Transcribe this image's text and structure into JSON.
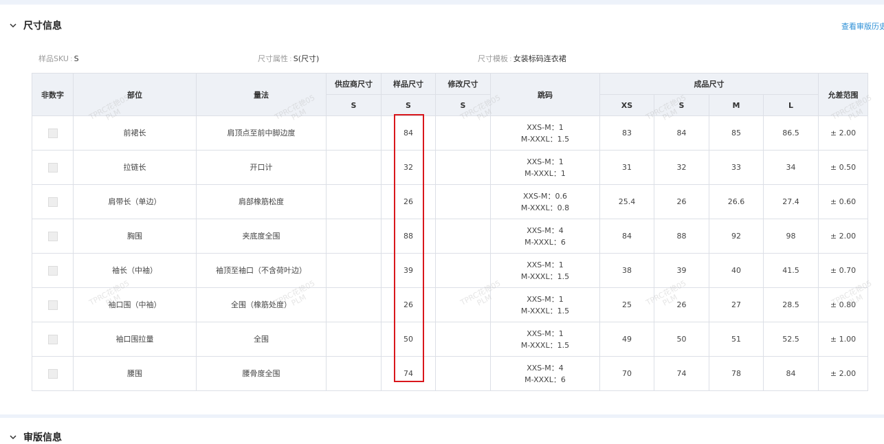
{
  "section": {
    "title": "尺寸信息",
    "history_link": "查看审版历史"
  },
  "info": [
    {
      "label": "样品SKU",
      "value": "S"
    },
    {
      "label": "尺寸属性",
      "value": "S(尺寸)"
    },
    {
      "label": "尺寸模板",
      "value": "女装标码连衣裙"
    }
  ],
  "table": {
    "headers": {
      "non_digit": "非数字",
      "part": "部位",
      "method": "量法",
      "supplier_size": "供应商尺寸",
      "sample_size": "样品尺寸",
      "modify_size": "修改尺寸",
      "jump": "跳码",
      "finished_size": "成品尺寸",
      "tolerance": "允差范围"
    },
    "sub_headers": {
      "supplier": "S",
      "sample": "S",
      "modify": "S",
      "finished": [
        "XS",
        "S",
        "M",
        "L"
      ]
    },
    "rows": [
      {
        "part": "前裙长",
        "method": "肩顶点至前中脚边度",
        "supplier": "",
        "sample": "84",
        "modify": "",
        "jump1": "XXS-M：1",
        "jump2": "M-XXXL：1.5",
        "xs": "83",
        "s": "84",
        "m": "85",
        "l": "86.5",
        "tol": "± 2.00"
      },
      {
        "part": "拉链长",
        "method": "开口计",
        "supplier": "",
        "sample": "32",
        "modify": "",
        "jump1": "XXS-M：1",
        "jump2": "M-XXXL：1",
        "xs": "31",
        "s": "32",
        "m": "33",
        "l": "34",
        "tol": "± 0.50"
      },
      {
        "part": "肩带长（单边）",
        "method": "肩部橡筋松度",
        "supplier": "",
        "sample": "26",
        "modify": "",
        "jump1": "XXS-M：0.6",
        "jump2": "M-XXXL：0.8",
        "xs": "25.4",
        "s": "26",
        "m": "26.6",
        "l": "27.4",
        "tol": "± 0.60"
      },
      {
        "part": "胸围",
        "method": "夹底度全围",
        "supplier": "",
        "sample": "88",
        "modify": "",
        "jump1": "XXS-M：4",
        "jump2": "M-XXXL：6",
        "xs": "84",
        "s": "88",
        "m": "92",
        "l": "98",
        "tol": "± 2.00"
      },
      {
        "part": "袖长（中袖）",
        "method": "袖顶至袖口（不含荷叶边）",
        "supplier": "",
        "sample": "39",
        "modify": "",
        "jump1": "XXS-M：1",
        "jump2": "M-XXXL：1.5",
        "xs": "38",
        "s": "39",
        "m": "40",
        "l": "41.5",
        "tol": "± 0.70"
      },
      {
        "part": "袖口围（中袖）",
        "method": "全围（橡筋处度）",
        "supplier": "",
        "sample": "26",
        "modify": "",
        "jump1": "XXS-M：1",
        "jump2": "M-XXXL：1.5",
        "xs": "25",
        "s": "26",
        "m": "27",
        "l": "28.5",
        "tol": "± 0.80"
      },
      {
        "part": "袖口围拉量",
        "method": "全围",
        "supplier": "",
        "sample": "50",
        "modify": "",
        "jump1": "XXS-M：1",
        "jump2": "M-XXXL：1.5",
        "xs": "49",
        "s": "50",
        "m": "51",
        "l": "52.5",
        "tol": "± 1.00"
      },
      {
        "part": "腰围",
        "method": "腰骨度全围",
        "supplier": "",
        "sample": "74",
        "modify": "",
        "jump1": "XXS-M：4",
        "jump2": "M-XXXL：6",
        "xs": "70",
        "s": "74",
        "m": "78",
        "l": "84",
        "tol": "± 2.00"
      }
    ]
  },
  "watermark": {
    "line1": "TPRC花艳05",
    "line2": "PLM"
  },
  "next_section": {
    "title": "审版信息"
  },
  "colors": {
    "link": "#2c8fd6",
    "highlight": "#d9161b",
    "header_bg": "#eef1f6",
    "border": "#dcdfe6"
  }
}
